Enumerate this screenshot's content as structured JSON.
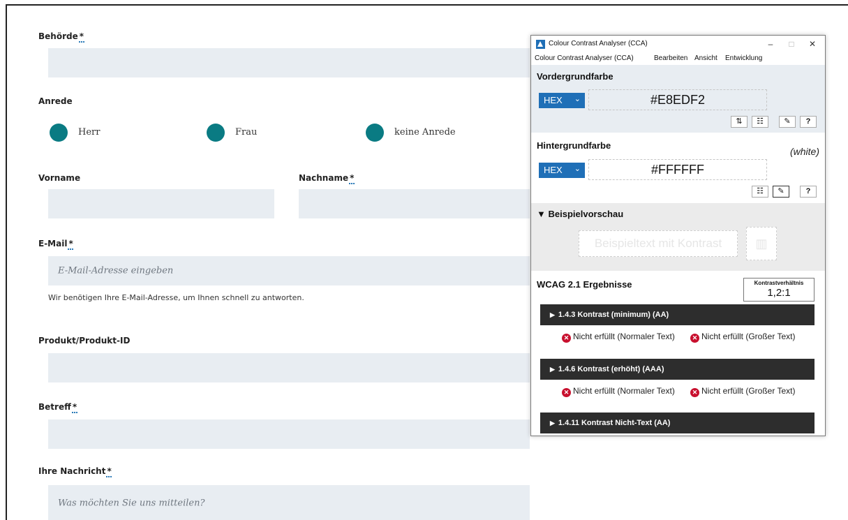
{
  "form": {
    "authority": {
      "label": "Behörde",
      "required": "*"
    },
    "salutation": {
      "label": "Anrede",
      "options": [
        {
          "label": "Herr"
        },
        {
          "label": "Frau"
        },
        {
          "label": "keine Anrede"
        }
      ]
    },
    "first_name": {
      "label": "Vorname"
    },
    "last_name": {
      "label": "Nachname",
      "required": "*"
    },
    "email": {
      "label": "E-Mail",
      "required": "*",
      "placeholder": "E-Mail-Adresse eingeben",
      "hint": "Wir benötigen Ihre E-Mail-Adresse, um Ihnen schnell zu antworten."
    },
    "product": {
      "label": "Produkt/Produkt-ID"
    },
    "subject": {
      "label": "Betreff",
      "required": "*"
    },
    "message": {
      "label": "Ihre Nachricht",
      "required": "*",
      "placeholder": "Was möchten Sie uns mitteilen?"
    },
    "colors": {
      "field_bg": "#E8EDF2",
      "radio": "#0A7B83",
      "required_underline": "#2A7AB8"
    }
  },
  "cca": {
    "window_title": "Colour Contrast Analyser (CCA)",
    "window_buttons": {
      "minimize": "–",
      "maximize": "□",
      "close": "✕"
    },
    "menu": [
      "Colour Contrast Analyser (CCA)",
      "Bearbeiten",
      "Ansicht",
      "Entwicklung"
    ],
    "foreground": {
      "title": "Vordergrundfarbe",
      "format": "HEX",
      "value": "#E8EDF2",
      "tools": [
        {
          "icon": "swap-icon",
          "glyph": "⇅"
        },
        {
          "icon": "sliders-icon",
          "glyph": "☷"
        },
        {
          "icon": "eyedropper-icon",
          "glyph": "✎"
        },
        {
          "icon": "help-icon",
          "glyph": "?"
        }
      ]
    },
    "background": {
      "title": "Hintergrundfarbe",
      "note": "(white)",
      "format": "HEX",
      "value": "#FFFFFF",
      "tools": [
        {
          "icon": "sliders-icon",
          "glyph": "☷"
        },
        {
          "icon": "eyedropper-icon",
          "glyph": "✎"
        },
        {
          "icon": "help-icon",
          "glyph": "?"
        }
      ]
    },
    "preview": {
      "title": "▼ Beispielvorschau",
      "sample_text": "Beispieltext mit Kontrast",
      "sample_icon": "chart-icon"
    },
    "wcag": {
      "title": "WCAG 2.1 Ergebnisse",
      "ratio_label": "Kontrastverhältnis",
      "ratio_value": "1,2:1",
      "criteria": [
        {
          "label": "1.4.3 Kontrast (minimum) (AA)",
          "results": [
            "Nicht erfüllt (Normaler Text)",
            "Nicht erfüllt (Großer Text)"
          ]
        },
        {
          "label": "1.4.6 Kontrast (erhöht) (AAA)",
          "results": [
            "Nicht erfüllt (Normaler Text)",
            "Nicht erfüllt (Großer Text)"
          ]
        },
        {
          "label": "1.4.11 Kontrast Nicht-Text (AA)",
          "results": []
        }
      ]
    },
    "colors": {
      "accent": "#1F6FB7",
      "fail": "#C8102E",
      "criterion_bar": "#2D2D2D"
    }
  }
}
